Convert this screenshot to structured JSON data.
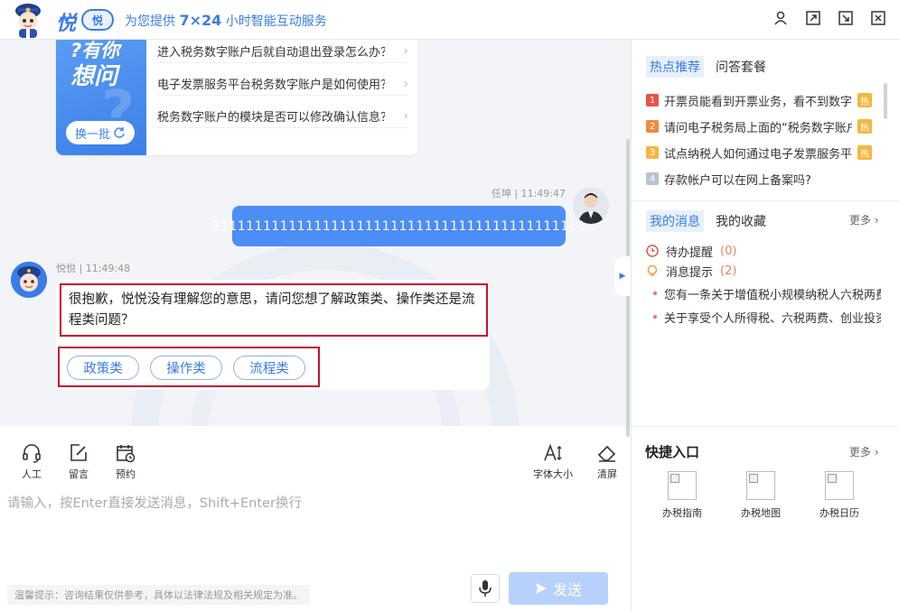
{
  "header": {
    "logo_text": "悦",
    "logo_badge": "悦",
    "slogan_pre": "为您提供 ",
    "slogan_bold": "7×24",
    "slogan_post": " 小时智能互动服务"
  },
  "question_card": {
    "banner_line1": "?有你",
    "banner_line2": "想问",
    "swap_label": "换一批",
    "items": [
      "进入税务数字账户后就自动退出登录怎么办？",
      "电子发票服务平台税务数字账户是如何使用？",
      "税务数字账户的模块是否可以修改确认信息？"
    ]
  },
  "user_message": {
    "meta": "任坤 | 11:49:47",
    "text": "11111111111111111111111111111111111111111111"
  },
  "bot_message": {
    "meta": "悦悦 | 11:49:48",
    "text": "很抱歉，悦悦没有理解您的意思，请问您想了解政策类、操作类还是流程类问题？",
    "options": [
      "政策类",
      "操作类",
      "流程类"
    ]
  },
  "toolbar": {
    "human": "人工",
    "message": "留言",
    "appointment": "预约",
    "font_size": "字体大小",
    "clear": "清屏"
  },
  "input": {
    "placeholder": "请输入，按Enter直接发送消息，Shift+Enter换行"
  },
  "tip": "温馨提示：咨询结果仅供参考，具体以法律法规及相关规定为准。",
  "send_label": "发送",
  "hot": {
    "tab_active": "热点推荐",
    "tab_other": "问答套餐",
    "tag": "热",
    "items": [
      {
        "rank": "1",
        "text": "开票员能看到开票业务，看不到数字账户？",
        "color": "#e8534a",
        "hot": true
      },
      {
        "rank": "2",
        "text": "请问电子税务局上面的“税务数字账户”在哪？",
        "color": "#f08a3c",
        "hot": true
      },
      {
        "rank": "3",
        "text": "试点纳税人如何通过电子发票服务平台开票？",
        "color": "#f4b740",
        "hot": true
      },
      {
        "rank": "4",
        "text": "存款帐户可以在网上备案吗?",
        "color": "#b8c2d0",
        "hot": false
      }
    ]
  },
  "messages": {
    "tab_active": "我的消息",
    "tab_other": "我的收藏",
    "more": "更多",
    "todo_label": "待办提醒",
    "todo_count": "(0)",
    "notice_label": "消息提示",
    "notice_count": "(2)",
    "notices": [
      "您有一条关于增值税小规模纳税人六税两费减征",
      "关于享受个人所得税、六税两费、创业投资优惠"
    ]
  },
  "quick": {
    "title": "快捷入口",
    "more": "更多",
    "items": [
      "办税指南",
      "办税地图",
      "办税日历"
    ]
  }
}
